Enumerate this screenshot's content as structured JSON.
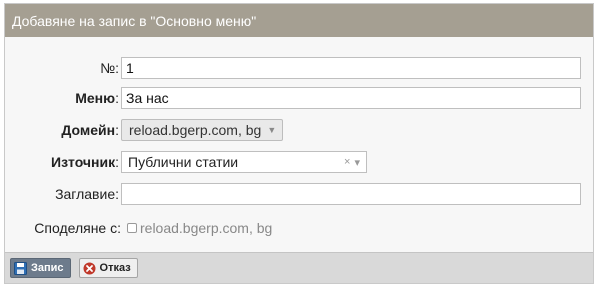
{
  "dialog": {
    "title": "Добавяне на запис в \"Основно меню\""
  },
  "fields": {
    "number": {
      "label": "№:",
      "value": "1"
    },
    "menu": {
      "label": "Меню",
      "label_suffix": ":",
      "value": "За нас"
    },
    "domain": {
      "label": "Домейн",
      "label_suffix": ":",
      "value": "reload.bgerp.com, bg"
    },
    "source": {
      "label": "Източник",
      "label_suffix": ":",
      "value": "Публични статии",
      "clear": "×",
      "arrow": "▾"
    },
    "title": {
      "label": "Заглавие:",
      "value": ""
    },
    "share": {
      "label": "Споделяне с:",
      "option": "reload.bgerp.com, bg",
      "checked": false
    }
  },
  "toolbar": {
    "save_label": "Запис",
    "cancel_label": "Отказ"
  },
  "colors": {
    "title_bar": "#a59f92",
    "save_button": "#6d7b8c",
    "cancel_icon": "#c0392b"
  }
}
